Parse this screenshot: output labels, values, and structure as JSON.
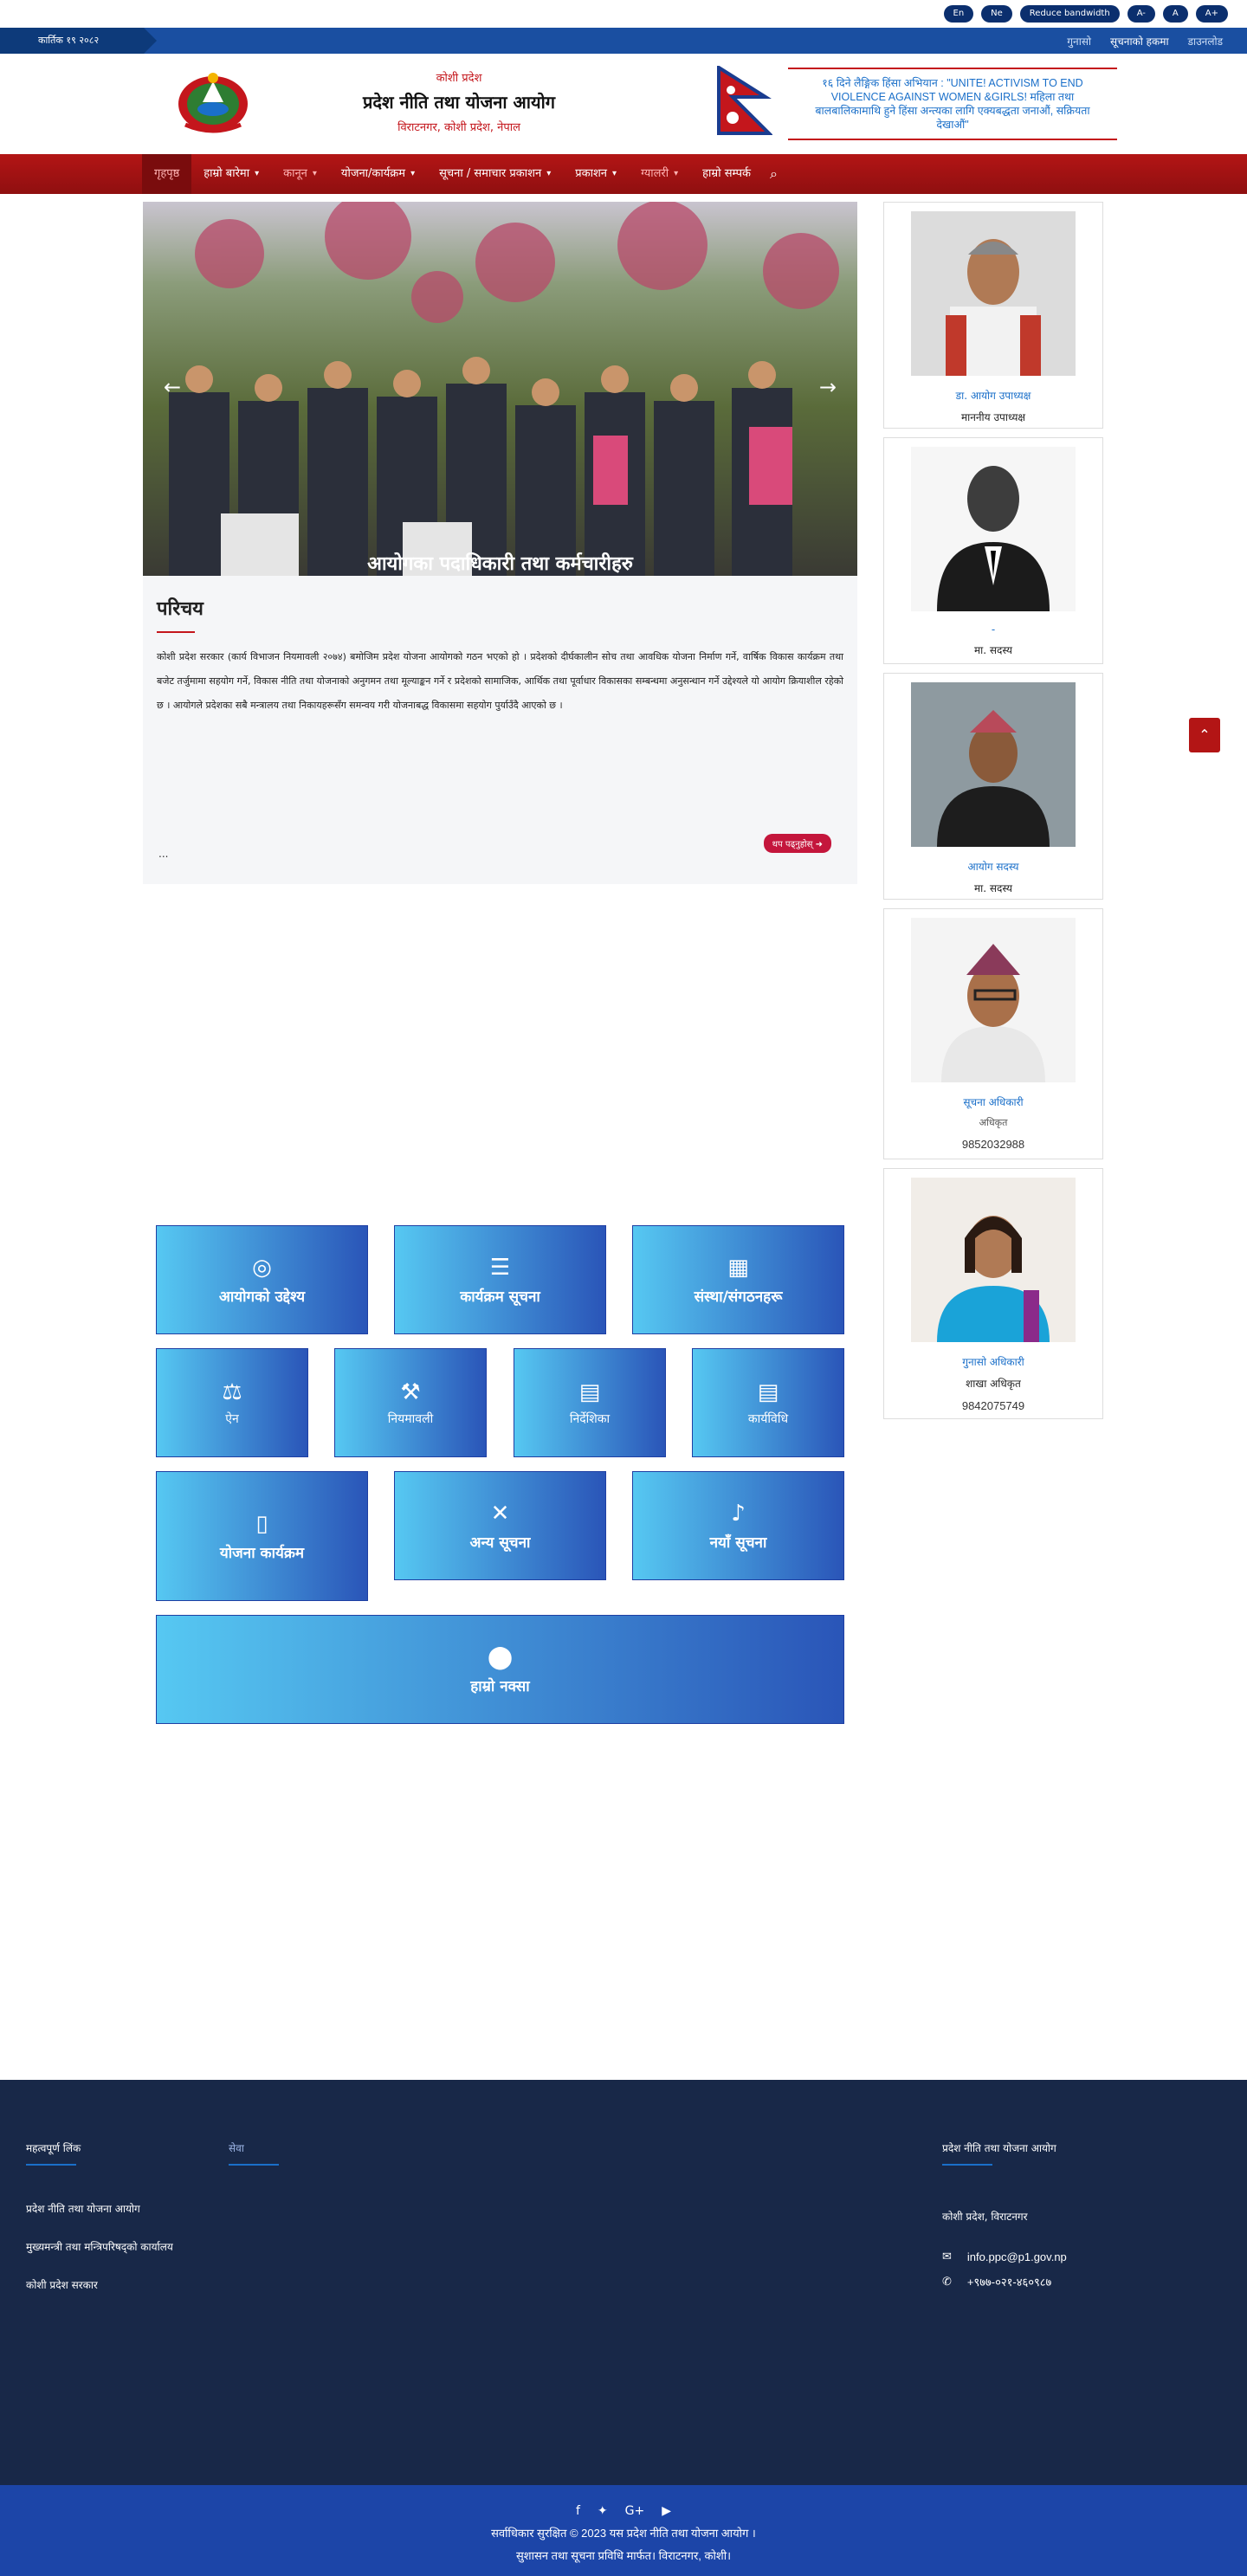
{
  "utility": {
    "buttons": [
      "En",
      "Ne",
      "Reduce bandwidth",
      "A-",
      "A",
      "A+"
    ]
  },
  "info_bar": {
    "date": "कार्तिक १९ २०८२",
    "links": [
      "गुनासो",
      "सूचनाको हकमा",
      "डाउनलोड"
    ]
  },
  "header": {
    "small_title": "कोशी प्रदेश",
    "office_name": "प्रदेश नीति तथा योजना आयोग",
    "address": "विराटनगर, कोशी प्रदेश, नेपाल",
    "marquee": "१६ दिने लैङ्गिक हिंसा अभियान : \"UNITE! ACTIVISM TO END VIOLENCE AGAINST WOMEN &GIRLS! महिला तथा बालबालिकामाथि हुने हिंसा अन्त्यका लागि एक्यबद्धता जनाऔं, सक्रियता देखाऔं\""
  },
  "nav": {
    "items": [
      {
        "label": "गृहपृष्ठ",
        "caret": false,
        "active": true
      },
      {
        "label": "हाम्रो बारेमा",
        "caret": true,
        "active": false
      },
      {
        "label": "कानून",
        "caret": true,
        "active": false
      },
      {
        "label": "योजना/कार्यक्रम",
        "caret": true,
        "active": false
      },
      {
        "label": "सूचना / समाचार प्रकाशन",
        "caret": true,
        "active": false
      },
      {
        "label": "प्रकाशन",
        "caret": true,
        "active": false
      },
      {
        "label": "ग्यालरी",
        "caret": true,
        "active": false
      },
      {
        "label": "हाम्रो सम्पर्क",
        "caret": false,
        "active": false
      }
    ]
  },
  "hero": {
    "caption": "आयोगका पदाधिकारी तथा कर्मचारीहरु"
  },
  "intro": {
    "title": "परिचय",
    "text": "कोशी प्रदेश सरकार (कार्य विभाजन नियमावली २०७४) बमोजिम प्रदेश योजना आयोगको गठन भएको हो । प्रदेशको दीर्घकालीन सोच तथा आवधिक योजना निर्माण गर्ने, वार्षिक विकास कार्यक्रम तथा बजेट तर्जुमामा सहयोग गर्ने, विकास नीति तथा योजनाको अनुगमन तथा मूल्याङ्कन गर्ने र प्रदेशको सामाजिक, आर्थिक तथा पूर्वाधार विकासका सम्बन्धमा अनुसन्धान गर्ने उद्देश्यले यो आयोग क्रियाशील रहेको छ । आयोगले प्रदेशका सबै मन्त्रालय तथा निकायहरूसँग समन्वय गरी योजनाबद्ध विकासमा सहयोग पुर्याउँदै आएको छ ।",
    "more": "...",
    "read_more": "थप पढ्नुहोस्"
  },
  "sidebar": [
    {
      "name": "डा. आयोग उपाध्यक्ष",
      "role": "माननीय उपाध्यक्ष",
      "phone": ""
    },
    {
      "name": "-",
      "role": "मा. सदस्य",
      "phone": ""
    },
    {
      "name": "आयोग सदस्य",
      "role": "मा. सदस्य",
      "phone": ""
    },
    {
      "name": "सूचना अधिकारी",
      "role": "अधिकृत",
      "phone": "9852032988"
    },
    {
      "name": "गुनासो अधिकारी",
      "role": "शाखा अधिकृत",
      "phone": "9842075749"
    }
  ],
  "tiles": {
    "row1": [
      {
        "label": "आयोगको उद्देश्य",
        "icon": "target-icon",
        "glyph": "◎"
      },
      {
        "label": "कार्यक्रम सूचना",
        "icon": "list-icon",
        "glyph": "☰"
      },
      {
        "label": "संस्था/संगठनहरू",
        "icon": "building-icon",
        "glyph": "▦"
      }
    ],
    "row2": [
      {
        "label": "ऐन",
        "icon": "scale-icon",
        "glyph": "⚖"
      },
      {
        "label": "नियमावली",
        "icon": "gavel-icon",
        "glyph": "⚒"
      },
      {
        "label": "निर्देशिका",
        "icon": "book-icon",
        "glyph": "▤"
      },
      {
        "label": "कार्यविधि",
        "icon": "book-icon",
        "glyph": "▤"
      }
    ],
    "row3": [
      {
        "label": "योजना कार्यक्रम",
        "icon": "document-icon",
        "glyph": "▯"
      },
      {
        "label": "अन्य सूचना",
        "icon": "bell-slash-icon",
        "glyph": "✕"
      },
      {
        "label": "नयाँ सूचना",
        "icon": "bell-icon",
        "glyph": "♪"
      }
    ],
    "map": {
      "label": "हाम्रो नक्सा",
      "icon": "map-pin-icon",
      "glyph": "⬤"
    }
  },
  "footer": {
    "col1_title": "महत्वपूर्ण लिंक",
    "col1_links": [
      "प्रदेश नीति तथा योजना आयोग",
      "मुख्यमन्त्री तथा मन्त्रिपरिषद्को कार्यालय",
      "कोशी प्रदेश सरकार"
    ],
    "col2_title": "सेवा",
    "col3_title": "प्रदेश नीति तथा योजना आयोग",
    "address": "कोशी प्रदेश, विराटनगर",
    "email": "info.ppc@p1.gov.np",
    "phone": "+९७७-०२१-४६०९८७",
    "copyright": "सर्वाधिकार सुरक्षित © 2023 यस प्रदेश नीति तथा योजना आयोग ।",
    "credit": "सुशासन तथा सूचना प्रविधि मार्फत। विराटनगर, कोशी।"
  },
  "colors": {
    "nav_red": "#b31515",
    "brand_blue": "#1a4fa1",
    "footer_navy": "#182848",
    "accent_red": "#c4161c"
  }
}
